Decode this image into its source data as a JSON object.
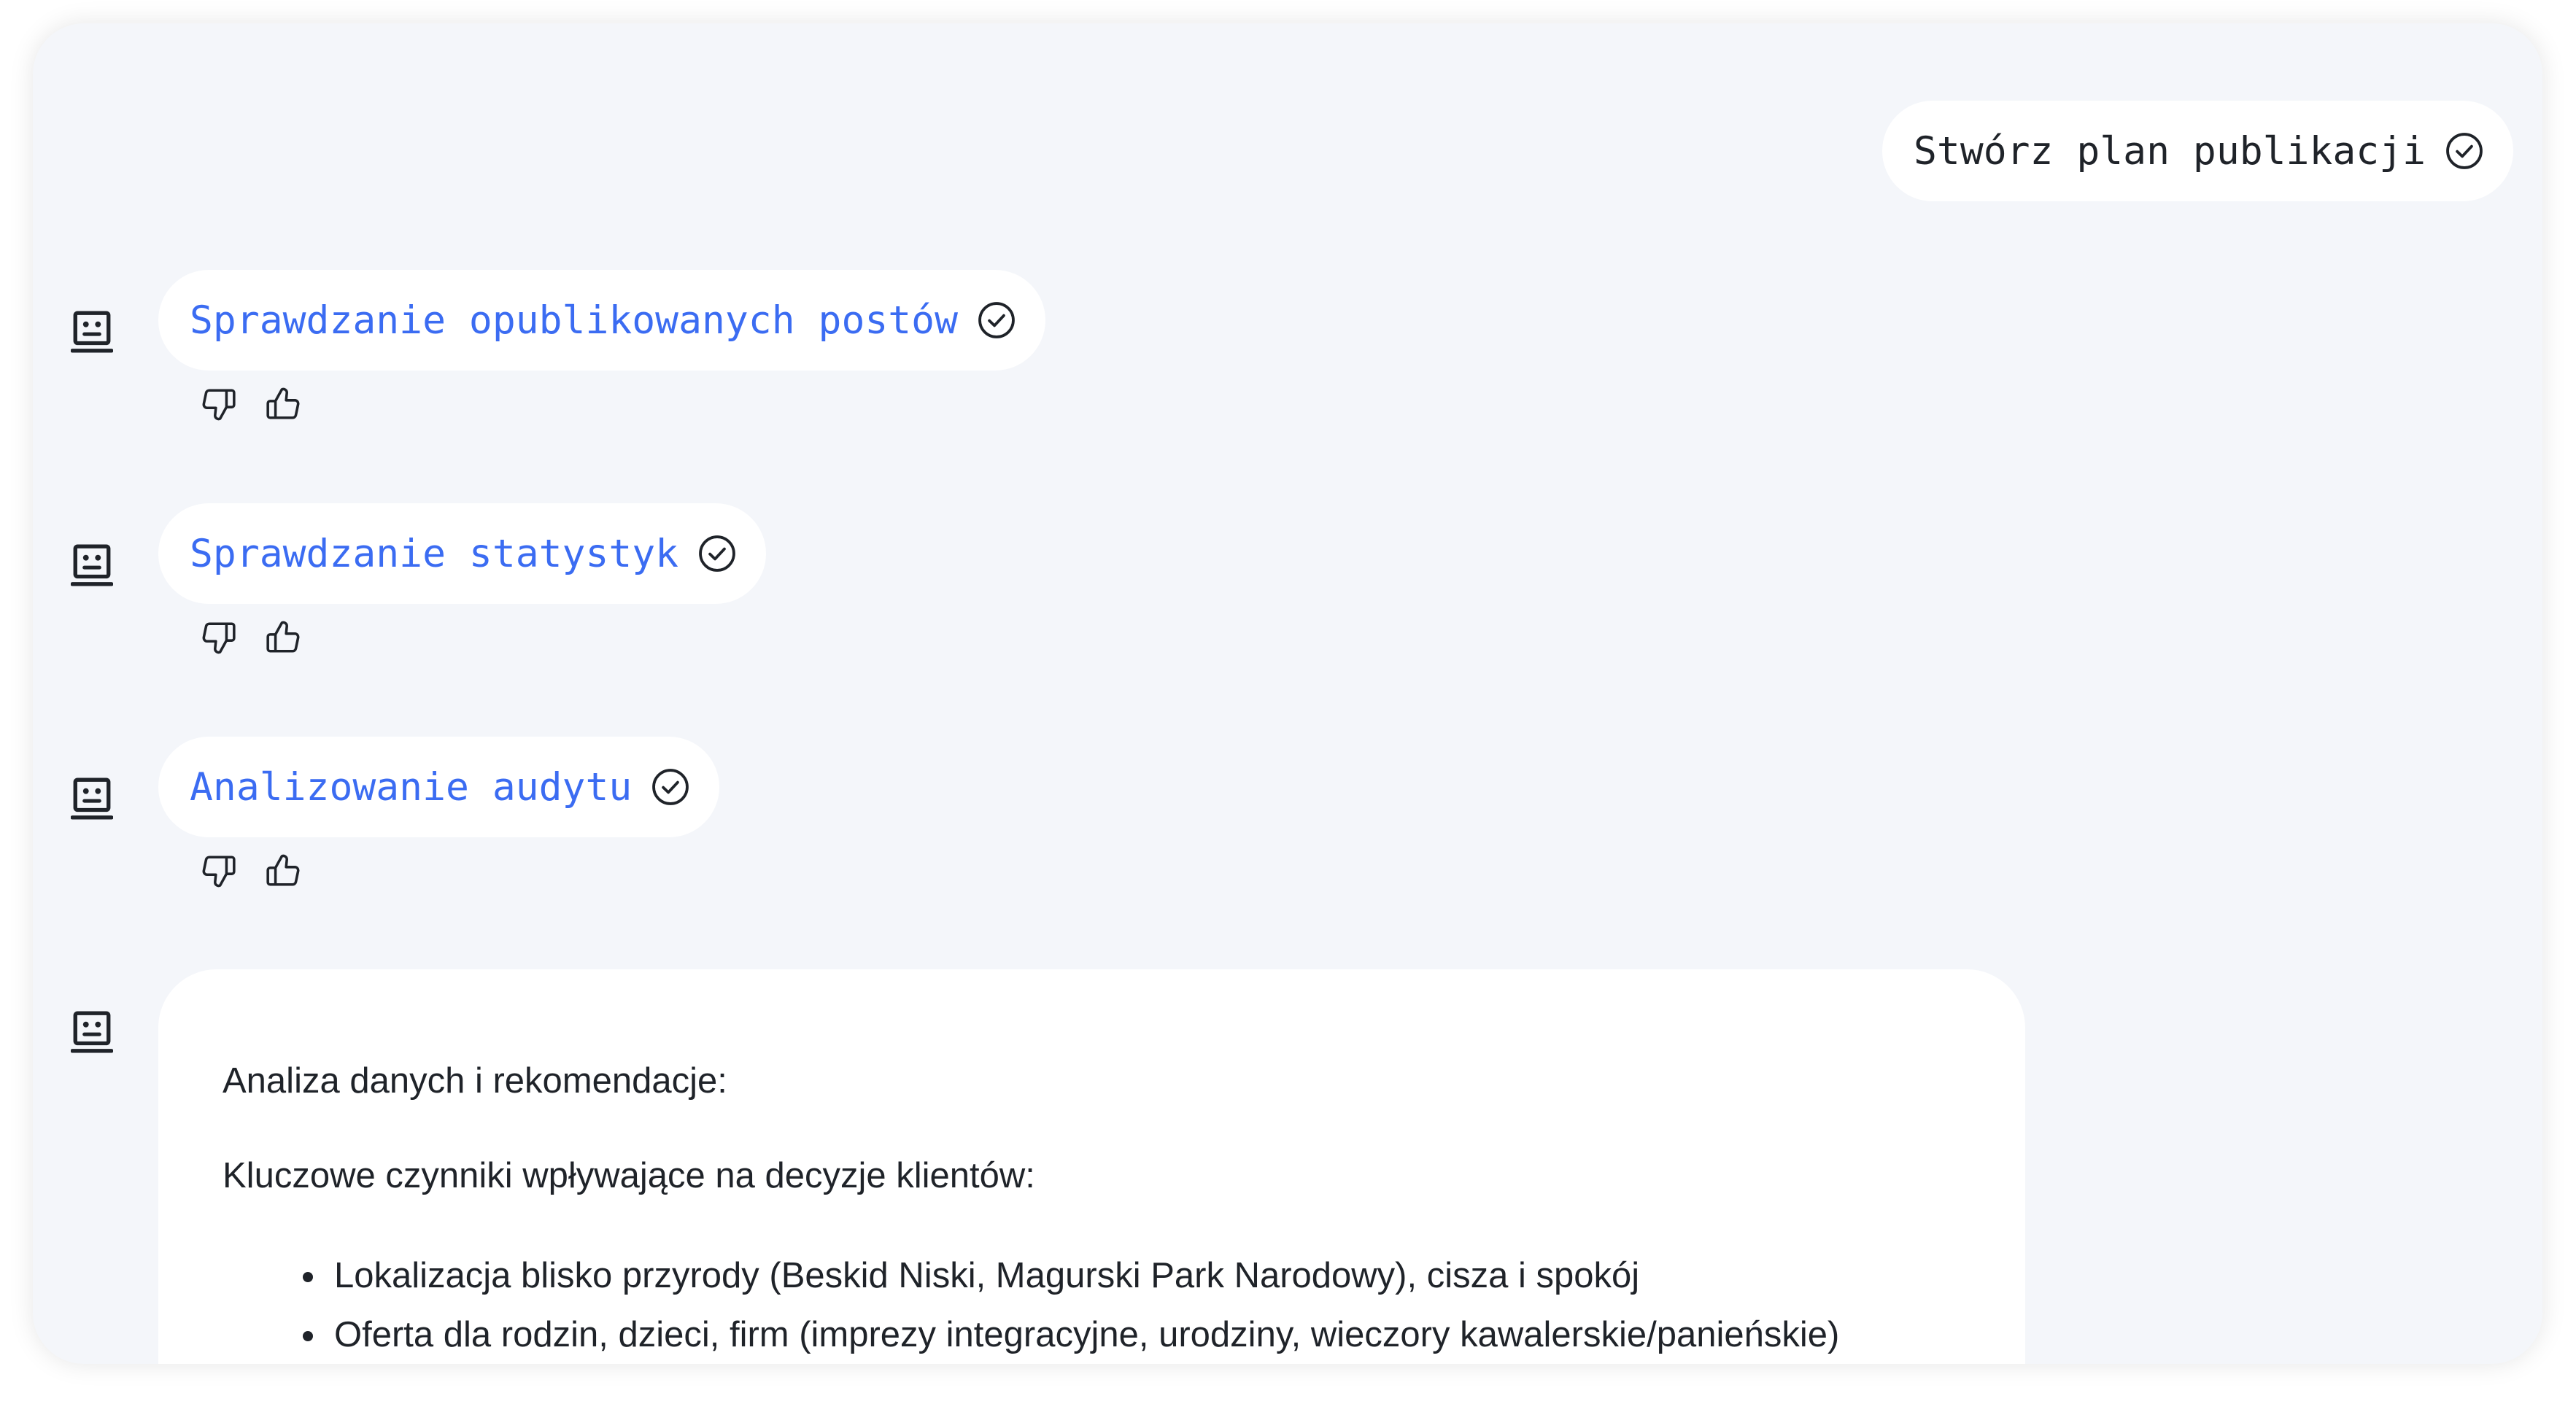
{
  "user_message": {
    "text": "Stwórz plan publikacji",
    "status_icon": "check-circle-icon"
  },
  "steps": [
    {
      "label": "Sprawdzanie opublikowanych postów",
      "status_icon": "check-circle-icon"
    },
    {
      "label": "Sprawdzanie statystyk",
      "status_icon": "check-circle-icon"
    },
    {
      "label": "Analizowanie audytu",
      "status_icon": "check-circle-icon"
    }
  ],
  "response": {
    "heading": "Analiza danych i rekomendacje:",
    "subheading": "Kluczowe czynniki wpływające na decyzje klientów:",
    "bullets": [
      "Lokalizacja blisko przyrody (Beskid Niski, Magurski Park Narodowy), cisza i spokój",
      "Oferta dla rodzin, dzieci, firm (imprezy integracyjne, urodziny, wieczory kawalerskie/panieńskie)"
    ]
  },
  "icons": {
    "assistant_avatar": "robot-face-icon",
    "thumbs_down": "thumbs-down-icon",
    "thumbs_up": "thumbs-up-icon"
  },
  "colors": {
    "background": "#f4f6fa",
    "bubble": "#ffffff",
    "step_text": "#3b6cf2",
    "text": "#1f2329"
  }
}
